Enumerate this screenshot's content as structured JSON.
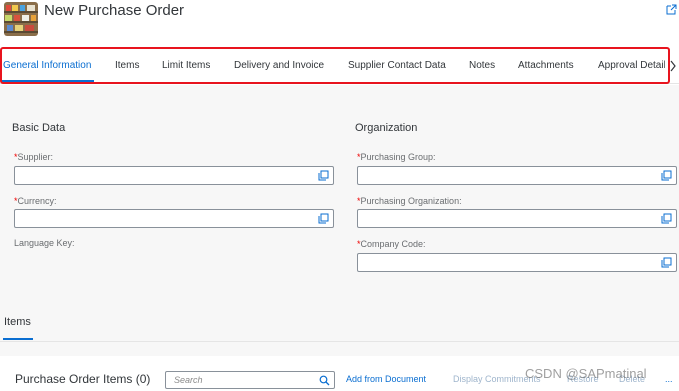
{
  "header": {
    "title": "New Purchase Order"
  },
  "tabs": [
    {
      "label": "General Information"
    },
    {
      "label": "Items"
    },
    {
      "label": "Limit Items"
    },
    {
      "label": "Delivery and Invoice"
    },
    {
      "label": "Supplier Contact Data"
    },
    {
      "label": "Notes"
    },
    {
      "label": "Attachments"
    },
    {
      "label": "Approval Details"
    }
  ],
  "basic_data": {
    "title": "Basic Data",
    "supplier_label": "Supplier:",
    "currency_label": "Currency:",
    "language_label": "Language Key:"
  },
  "organization": {
    "title": "Organization",
    "purch_group_label": "Purchasing Group:",
    "purch_org_label": "Purchasing Organization:",
    "company_code_label": "Company Code:"
  },
  "required_marker": "*",
  "items_section": {
    "label": "Items"
  },
  "items_toolbar": {
    "title": "Purchase Order Items (0)",
    "search_placeholder": "Search",
    "add_from_document": "Add from Document",
    "display_commitments": "Display Commitments",
    "restore": "Restore",
    "delete": "Delete",
    "more": "..."
  },
  "watermark": "CSDN @SAPmatinal",
  "colors": {
    "accent": "#0a6ed1",
    "highlight": "#e8141e",
    "required": "#e00000"
  }
}
